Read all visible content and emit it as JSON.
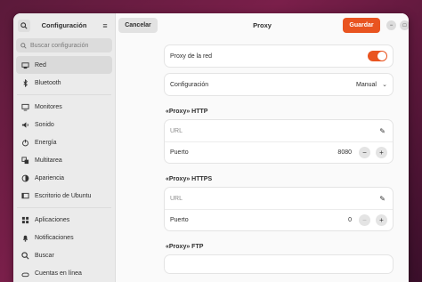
{
  "sidebar": {
    "title": "Configuración",
    "search_placeholder": "Buscar configuración",
    "items": [
      {
        "label": "Red",
        "icon": "network-icon"
      },
      {
        "label": "Bluetooth",
        "icon": "bluetooth-icon"
      },
      {
        "label": "Monitores",
        "icon": "monitor-icon"
      },
      {
        "label": "Sonido",
        "icon": "sound-icon"
      },
      {
        "label": "Energía",
        "icon": "power-icon"
      },
      {
        "label": "Multitarea",
        "icon": "multitask-icon"
      },
      {
        "label": "Apariencia",
        "icon": "appearance-icon"
      },
      {
        "label": "Escritorio de Ubuntu",
        "icon": "ubuntu-desktop-icon"
      },
      {
        "label": "Aplicaciones",
        "icon": "apps-icon"
      },
      {
        "label": "Notificaciones",
        "icon": "bell-icon"
      },
      {
        "label": "Buscar",
        "icon": "search-icon"
      },
      {
        "label": "Cuentas en línea",
        "icon": "accounts-icon"
      }
    ]
  },
  "header": {
    "cancel_label": "Cancelar",
    "title": "Proxy",
    "save_label": "Guardar",
    "accent": "#e95420"
  },
  "proxy": {
    "network_proxy_label": "Proxy de la red",
    "network_proxy_on": true,
    "config_label": "Configuración",
    "config_value": "Manual",
    "sections": [
      {
        "title": "«Proxy» HTTP",
        "url_placeholder": "URL",
        "port_label": "Puerto",
        "port_value": "8080"
      },
      {
        "title": "«Proxy» HTTPS",
        "url_placeholder": "URL",
        "port_label": "Puerto",
        "port_value": "0"
      },
      {
        "title": "«Proxy» FTP"
      }
    ]
  }
}
